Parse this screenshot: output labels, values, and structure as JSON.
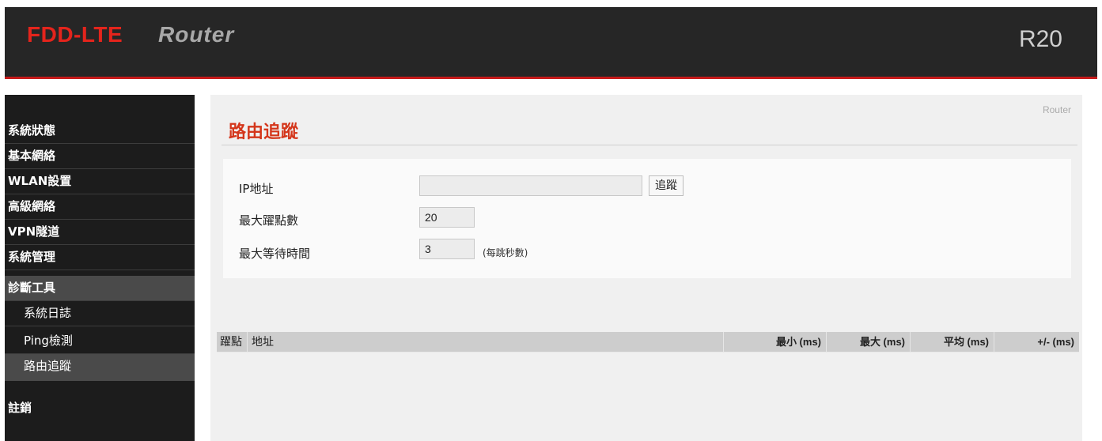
{
  "header": {
    "brand_primary": "FDD-LTE",
    "brand_secondary": "Router",
    "model": "R20",
    "accent_color": "#c51a1a"
  },
  "sidebar": {
    "items": [
      {
        "label": "系統狀態"
      },
      {
        "label": "基本網絡"
      },
      {
        "label": "WLAN設置"
      },
      {
        "label": "高級網絡"
      },
      {
        "label": "VPN隧道"
      },
      {
        "label": "系統管理"
      },
      {
        "label": "診斷工具",
        "active": true
      },
      {
        "label": "系統日誌",
        "sub": true
      },
      {
        "label": "Ping檢測",
        "sub": true
      },
      {
        "label": "路由追蹤",
        "sub": true,
        "active": true
      },
      {
        "label": "註銷"
      }
    ]
  },
  "main": {
    "breadcrumb": "Router",
    "title": "路由追蹤",
    "form": {
      "ip_label": "IP地址",
      "ip_value": "",
      "trace_button": "追蹤",
      "max_hops_label": "最大躍點數",
      "max_hops_value": "20",
      "max_wait_label": "最大等待時間",
      "max_wait_value": "3",
      "max_wait_hint": "(每跳秒數)"
    },
    "table": {
      "columns": [
        "躍點",
        "地址",
        "最小 (ms)",
        "最大 (ms)",
        "平均 (ms)",
        "+/- (ms)"
      ]
    }
  }
}
